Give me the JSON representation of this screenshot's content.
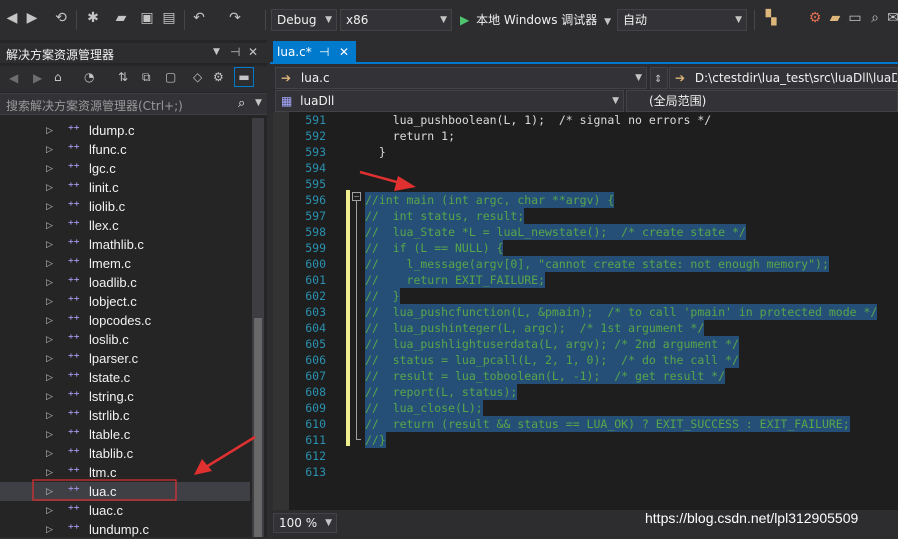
{
  "toolbar": {
    "config": "Debug",
    "platform": "x86",
    "run_label": "本地 Windows 调试器",
    "run_mode": "自动"
  },
  "solution_explorer": {
    "title": "解决方案资源管理器",
    "search_placeholder": "搜索解决方案资源管理器(Ctrl+;)",
    "items": [
      {
        "label": "ldump.c"
      },
      {
        "label": "lfunc.c"
      },
      {
        "label": "lgc.c"
      },
      {
        "label": "linit.c"
      },
      {
        "label": "liolib.c"
      },
      {
        "label": "llex.c"
      },
      {
        "label": "lmathlib.c"
      },
      {
        "label": "lmem.c"
      },
      {
        "label": "loadlib.c"
      },
      {
        "label": "lobject.c"
      },
      {
        "label": "lopcodes.c"
      },
      {
        "label": "loslib.c"
      },
      {
        "label": "lparser.c"
      },
      {
        "label": "lstate.c"
      },
      {
        "label": "lstring.c"
      },
      {
        "label": "lstrlib.c"
      },
      {
        "label": "ltable.c"
      },
      {
        "label": "ltablib.c"
      },
      {
        "label": "ltm.c"
      },
      {
        "label": "lua.c"
      },
      {
        "label": "luac.c"
      },
      {
        "label": "lundump.c"
      }
    ],
    "selected": "lua.c"
  },
  "editor": {
    "tab_label": "lua.c*",
    "pin_glyph": "⊣",
    "close_glyph": "✕",
    "file_combo": "lua.c",
    "path_combo": "D:\\ctestdir\\lua_test\\src\\luaDll\\luaDll\\",
    "project_combo": "luaDll",
    "scope_combo": "(全局范围)",
    "zoom": "100 %",
    "lines": [
      {
        "no": "591",
        "text": "    lua_pushboolean(L, 1);  /* signal no errors */"
      },
      {
        "no": "592",
        "text": "    return 1;"
      },
      {
        "no": "593",
        "text": "  }"
      },
      {
        "no": "594",
        "text": ""
      },
      {
        "no": "595",
        "text": ""
      },
      {
        "no": "596",
        "text": "//int main (int argc, char **argv) {"
      },
      {
        "no": "597",
        "text": "//  int status, result;"
      },
      {
        "no": "598",
        "text": "//  lua_State *L = luaL_newstate();  /* create state */"
      },
      {
        "no": "599",
        "text": "//  if (L == NULL) {"
      },
      {
        "no": "600",
        "text": "//    l_message(argv[0], \"cannot create state: not enough memory\");"
      },
      {
        "no": "601",
        "text": "//    return EXIT_FAILURE;"
      },
      {
        "no": "602",
        "text": "//  }"
      },
      {
        "no": "603",
        "text": "//  lua_pushcfunction(L, &pmain);  /* to call 'pmain' in protected mode */"
      },
      {
        "no": "604",
        "text": "//  lua_pushinteger(L, argc);  /* 1st argument */"
      },
      {
        "no": "605",
        "text": "//  lua_pushlightuserdata(L, argv); /* 2nd argument */"
      },
      {
        "no": "606",
        "text": "//  status = lua_pcall(L, 2, 1, 0);  /* do the call */"
      },
      {
        "no": "607",
        "text": "//  result = lua_toboolean(L, -1);  /* get result */"
      },
      {
        "no": "608",
        "text": "//  report(L, status);"
      },
      {
        "no": "609",
        "text": "//  lua_close(L);"
      },
      {
        "no": "610",
        "text": "//  return (result && status == LUA_OK) ? EXIT_SUCCESS : EXIT_FAILURE;"
      },
      {
        "no": "611",
        "text": "//}"
      },
      {
        "no": "612",
        "text": ""
      },
      {
        "no": "613",
        "text": ""
      }
    ]
  },
  "watermark": "https://blog.csdn.net/lpl312905509",
  "colors": {
    "accent": "#007acc",
    "annotation": "#e03030",
    "selection": "#264f78",
    "comment": "#57a64a"
  }
}
